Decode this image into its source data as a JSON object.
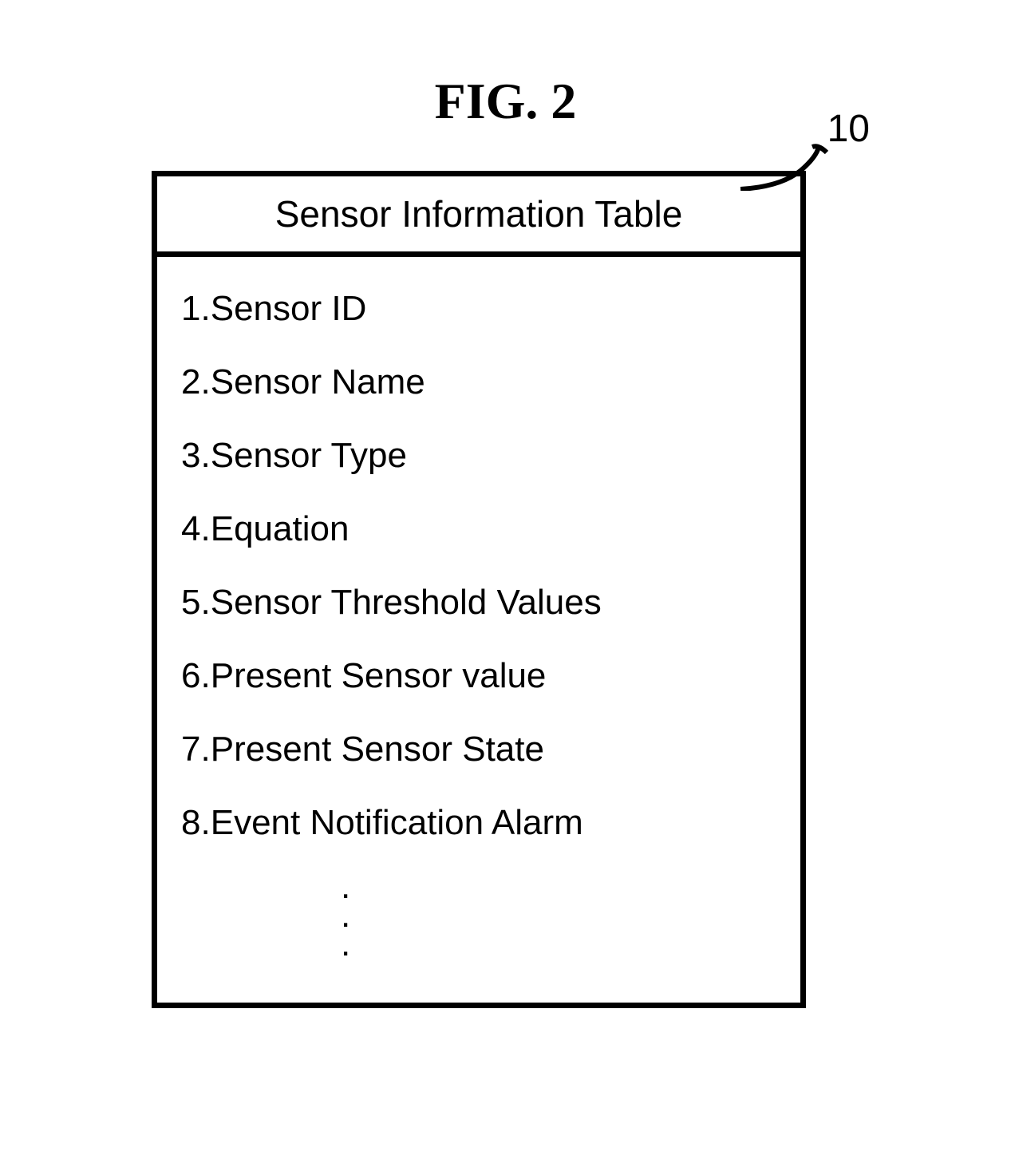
{
  "figure": {
    "title": "FIG. 2",
    "reference_number": "10"
  },
  "table": {
    "header": "Sensor Information Table",
    "rows": [
      {
        "num": "1",
        "label": "Sensor ID"
      },
      {
        "num": "2",
        "label": "Sensor Name"
      },
      {
        "num": "3",
        "label": "Sensor Type"
      },
      {
        "num": "4",
        "label": "Equation"
      },
      {
        "num": "5",
        "label": "Sensor Threshold Values"
      },
      {
        "num": "6",
        "label": "Present Sensor value"
      },
      {
        "num": "7",
        "label": "Present Sensor State"
      },
      {
        "num": "8",
        "label": "Event Notification Alarm"
      }
    ]
  }
}
